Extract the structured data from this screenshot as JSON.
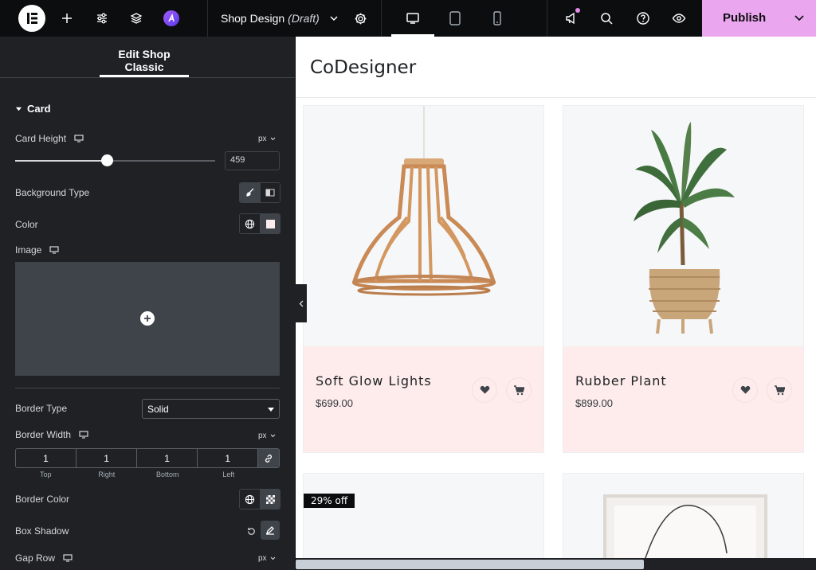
{
  "topbar": {
    "document_title": "Shop Design",
    "document_status": "(Draft)",
    "publish_label": "Publish"
  },
  "panel": {
    "header_tab": "Edit Shop Classic",
    "section_title": "Card",
    "card_height": {
      "label": "Card Height",
      "unit": "px",
      "value": "459",
      "slider_fraction": 0.46
    },
    "background_type": {
      "label": "Background Type"
    },
    "color": {
      "label": "Color"
    },
    "image": {
      "label": "Image"
    },
    "border_type": {
      "label": "Border Type",
      "selected": "Solid"
    },
    "border_width": {
      "label": "Border Width",
      "unit": "px",
      "values": [
        "1",
        "1",
        "1",
        "1"
      ],
      "sides": [
        "Top",
        "Right",
        "Bottom",
        "Left"
      ]
    },
    "border_color": {
      "label": "Border Color"
    },
    "box_shadow": {
      "label": "Box Shadow"
    },
    "gap_row": {
      "label": "Gap Row",
      "unit": "px"
    }
  },
  "preview": {
    "brand": "CoDesigner",
    "products": [
      {
        "name": "Soft Glow Lights",
        "price": "$699.00"
      },
      {
        "name": "Rubber Plant",
        "price": "$899.00"
      }
    ],
    "discount_badge": "29% off"
  },
  "colors": {
    "topbar_bg": "#0c0d0e",
    "panel_bg": "#1f2124",
    "publish_bg": "#eba6f0",
    "card_info_bg": "#fdeceb"
  }
}
